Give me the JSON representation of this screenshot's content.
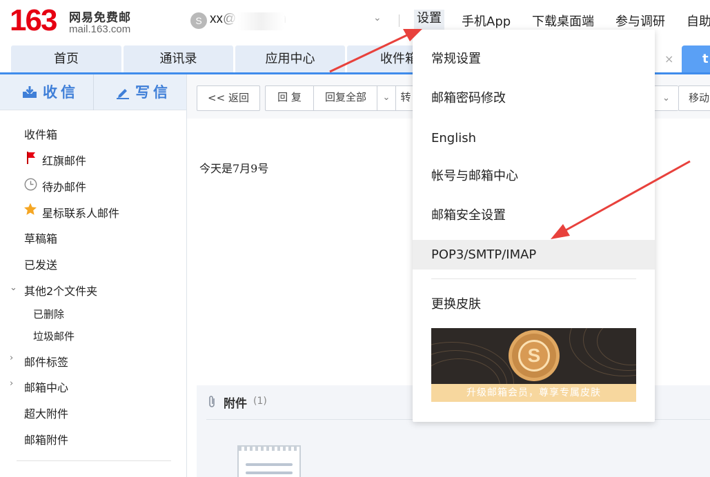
{
  "header": {
    "logo_number": "163",
    "logo_brand": "网易免费邮",
    "logo_url": "mail.163.com",
    "avatar_symbol": "S",
    "user_email": "xx@163.com",
    "chevron": "⌄",
    "nav": [
      {
        "label": "设置"
      },
      {
        "label": "手机App"
      },
      {
        "label": "下载桌面端"
      },
      {
        "label": "参与调研"
      },
      {
        "label": "自助"
      }
    ]
  },
  "tabs": [
    {
      "label": "首页"
    },
    {
      "label": "通讯录"
    },
    {
      "label": "应用中心"
    },
    {
      "label": "收件箱"
    }
  ],
  "tab_close": "×",
  "tab_active": "t",
  "sidebar": {
    "receive_label": "收信",
    "compose_label": "写信",
    "items": [
      {
        "label": "收件箱"
      },
      {
        "label": "红旗邮件",
        "icon": "red-flag-icon"
      },
      {
        "label": "待办邮件",
        "icon": "clock-icon"
      },
      {
        "label": "星标联系人邮件",
        "icon": "star-icon"
      },
      {
        "label": "草稿箱"
      },
      {
        "label": "已发送"
      },
      {
        "label": "其他2个文件夹",
        "expanded": true
      },
      {
        "label": "已删除"
      },
      {
        "label": "垃圾邮件"
      },
      {
        "label": "邮件标签"
      },
      {
        "label": "邮箱中心"
      },
      {
        "label": "超大附件"
      },
      {
        "label": "邮箱附件"
      }
    ]
  },
  "toolbar": {
    "back_label": "<< 返回",
    "reply_label": "回 复",
    "reply_all_label": "回复全部",
    "forward_label": "转",
    "move_label": "移动"
  },
  "mail": {
    "body_text": "今天是7月9号",
    "attachment_title": "附件",
    "attachment_count": "(1)"
  },
  "settings_menu": {
    "items": [
      {
        "label": "常规设置"
      },
      {
        "label": "邮箱密码修改"
      },
      {
        "label": "English"
      },
      {
        "label": "帐号与邮箱中心"
      },
      {
        "label": "邮箱安全设置"
      },
      {
        "label": "POP3/SMTP/IMAP",
        "highlighted": true
      },
      {
        "label": "更换皮肤"
      }
    ],
    "skin_badge": "S",
    "skin_banner_text": "升级邮箱会员，尊享专属皮肤"
  },
  "colors": {
    "brand_red": "#e60012",
    "accent_blue": "#3f8cec",
    "annotation_arrow": "#e8413c"
  }
}
